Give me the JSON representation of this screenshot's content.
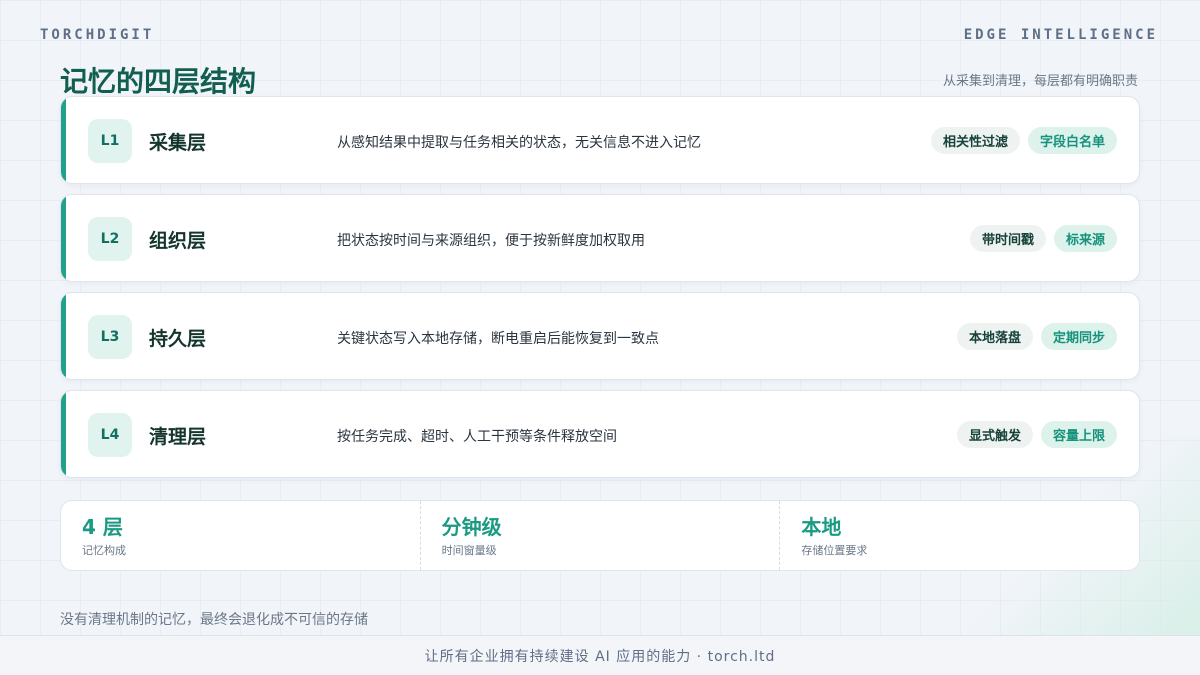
{
  "header": {
    "brand_left": "TORCHDIGIT",
    "brand_right": "EDGE INTELLIGENCE",
    "title": "记忆的四层结构",
    "subtitle": "从采集到清理，每层都有明确职责"
  },
  "layers": [
    {
      "num": "L1",
      "name": "采集层",
      "desc": "从感知结果中提取与任务相关的状态，无关信息不进入记忆",
      "tags": [
        "相关性过滤",
        "字段白名单"
      ]
    },
    {
      "num": "L2",
      "name": "组织层",
      "desc": "把状态按时间与来源组织，便于按新鲜度加权取用",
      "tags": [
        "带时间戳",
        "标来源"
      ]
    },
    {
      "num": "L3",
      "name": "持久层",
      "desc": "关键状态写入本地存储，断电重启后能恢复到一致点",
      "tags": [
        "本地落盘",
        "定期同步"
      ]
    },
    {
      "num": "L4",
      "name": "清理层",
      "desc": "按任务完成、超时、人工干预等条件释放空间",
      "tags": [
        "显式触发",
        "容量上限"
      ]
    }
  ],
  "stats": [
    {
      "value": "4 层",
      "label": "记忆构成"
    },
    {
      "value": "分钟级",
      "label": "时间窗量级"
    },
    {
      "value": "本地",
      "label": "存储位置要求"
    }
  ],
  "footnote": "没有清理机制的记忆，最终会退化成不可信的存储",
  "footer": "让所有企业拥有持续建设 AI 应用的能力 · torch.ltd",
  "colors": {
    "accent": "#22a08a",
    "title": "#125e50"
  }
}
